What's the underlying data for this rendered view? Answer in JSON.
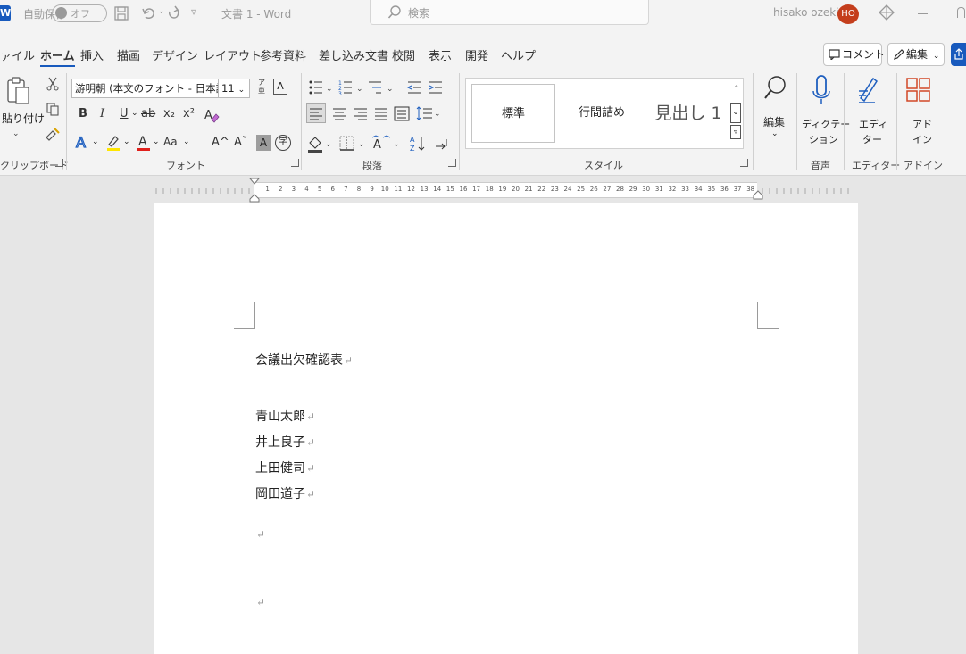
{
  "titlebar": {
    "app_logo": "W",
    "autosave_label": "自動保存",
    "autosave_state": "オフ",
    "document_title": "文書 1 - Word",
    "search_placeholder": "検索",
    "user_name": "hisako ozeki",
    "user_initials": "HO",
    "icons": [
      "save-icon",
      "undo-icon",
      "redo-icon",
      "customize-icon",
      "search-icon",
      "diamond-icon",
      "minimize-icon",
      "restore-icon"
    ]
  },
  "menu": {
    "tabs": [
      "ァイル",
      "ホーム",
      "挿入",
      "描画",
      "デザイン",
      "レイアウト",
      "参考資料",
      "差し込み文書",
      "校閲",
      "表示",
      "開発",
      "ヘルプ"
    ],
    "active_tab": "ホーム",
    "comment_label": "コメント",
    "edit_label": "編集"
  },
  "ribbon": {
    "clipboard": {
      "paste_label": "貼り付け",
      "group_label": "クリップボード"
    },
    "font": {
      "font_name": "游明朝 (本文のフォント - 日本語)",
      "font_size": "11",
      "bold": "B",
      "italic": "I",
      "underline": "U",
      "strike": "ab",
      "subscript": "x₂",
      "superscript": "x²",
      "change_case": "Aa",
      "grow": "A^",
      "shrink": "Aˇ",
      "group_label": "フォント"
    },
    "paragraph": {
      "group_label": "段落"
    },
    "styles": {
      "items": [
        "標準",
        "行間詰め",
        "見出し 1"
      ],
      "group_label": "スタイル"
    },
    "editing": {
      "label": "編集"
    },
    "voice": {
      "label_line1": "ディクテー",
      "label_line2": "ション",
      "group_label": "音声"
    },
    "editor": {
      "label_line1": "エディ",
      "label_line2": "ター",
      "group_label": "エディター"
    },
    "addins": {
      "label_line1": "アド",
      "label_line2": "イン",
      "group_label": "アドイン"
    }
  },
  "ruler": {
    "numbers": [
      "1",
      "2",
      "3",
      "4",
      "5",
      "6",
      "7",
      "8",
      "9",
      "10",
      "11",
      "12",
      "13",
      "14",
      "15",
      "16",
      "17",
      "18",
      "19",
      "20",
      "21",
      "22",
      "23",
      "24",
      "25",
      "26",
      "27",
      "28",
      "29",
      "30",
      "31",
      "32",
      "33",
      "34",
      "35",
      "36",
      "37",
      "38"
    ]
  },
  "document": {
    "title": "会議出欠確認表",
    "names": [
      "青山太郎",
      "井上良子",
      "上田健司",
      "岡田道子"
    ],
    "paragraph_mark": "↵"
  }
}
